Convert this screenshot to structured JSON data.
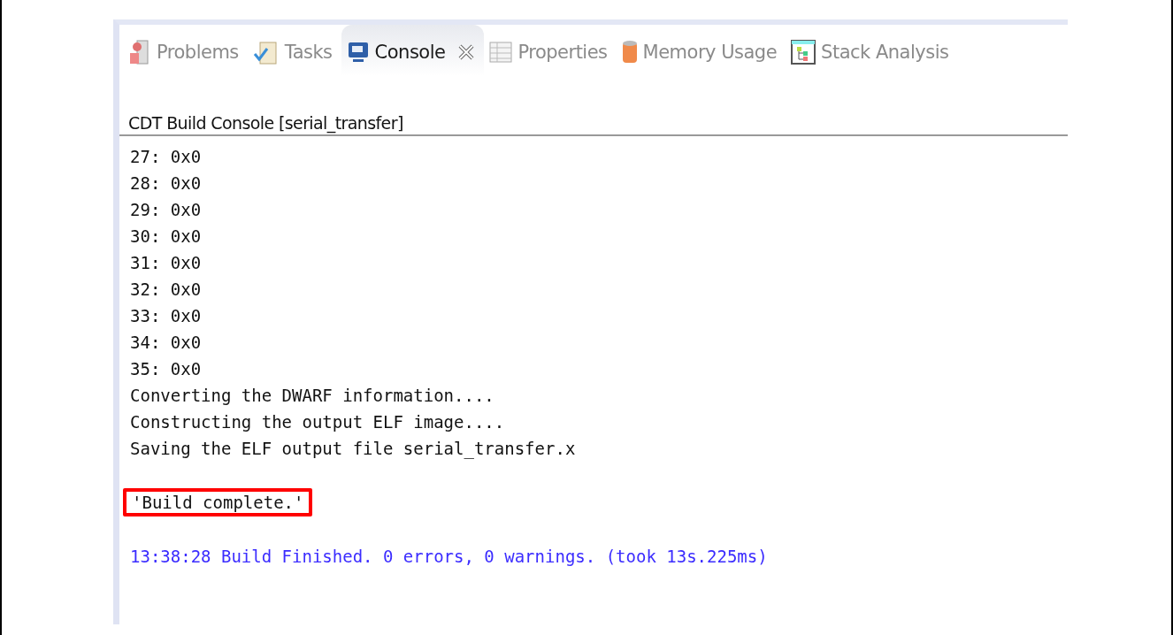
{
  "tabs": [
    {
      "label": "Problems",
      "kind": "problems",
      "selected": false,
      "closable": false
    },
    {
      "label": "Tasks",
      "kind": "tasks",
      "selected": false,
      "closable": false
    },
    {
      "label": "Console",
      "kind": "console",
      "selected": true,
      "closable": true
    },
    {
      "label": "Properties",
      "kind": "properties",
      "selected": false,
      "closable": false
    },
    {
      "label": "Memory Usage",
      "kind": "memory",
      "selected": false,
      "closable": false
    },
    {
      "label": "Stack Analysis",
      "kind": "stack",
      "selected": false,
      "closable": false
    }
  ],
  "console": {
    "title": "CDT Build Console [serial_transfer]",
    "lines": [
      {
        "kind": "text",
        "text": "27: 0x0"
      },
      {
        "kind": "text",
        "text": "28: 0x0"
      },
      {
        "kind": "text",
        "text": "29: 0x0"
      },
      {
        "kind": "text",
        "text": "30: 0x0"
      },
      {
        "kind": "text",
        "text": "31: 0x0"
      },
      {
        "kind": "text",
        "text": "32: 0x0"
      },
      {
        "kind": "text",
        "text": "33: 0x0"
      },
      {
        "kind": "text",
        "text": "34: 0x0"
      },
      {
        "kind": "text",
        "text": "35: 0x0"
      },
      {
        "kind": "text",
        "text": "Converting the DWARF information...."
      },
      {
        "kind": "text",
        "text": "Constructing the output ELF image...."
      },
      {
        "kind": "text",
        "text": "Saving the ELF output file serial_transfer.x"
      },
      {
        "kind": "highlighted",
        "text": "'Build complete.'"
      },
      {
        "kind": "status",
        "text": "13:38:28 Build Finished. 0 errors, 0 warnings. (took 13s.225ms)"
      }
    ]
  }
}
